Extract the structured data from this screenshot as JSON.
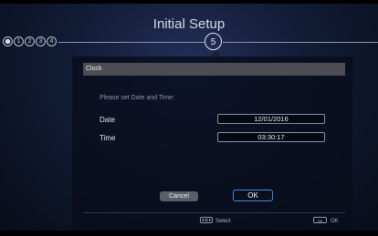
{
  "header": {
    "title": "Initial Setup",
    "current_step": "5",
    "steps": [
      "",
      "1",
      "2",
      "3",
      "4"
    ]
  },
  "dialog": {
    "title": "Clock",
    "prompt": "Please set Date and Time:",
    "date_label": "Date",
    "date_value": "12/01/2016",
    "time_label": "Time",
    "time_value": "03:30:17",
    "cancel_label": "Cancel",
    "ok_label": "OK"
  },
  "footer": {
    "select_label": "Select",
    "ok_label": "OK",
    "ok_key": "OK"
  },
  "colors": {
    "background": "#0d1626",
    "accent": "#3f8bdc"
  },
  "icons": {
    "select": "dpad-icon",
    "ok": "ok-key-icon"
  }
}
